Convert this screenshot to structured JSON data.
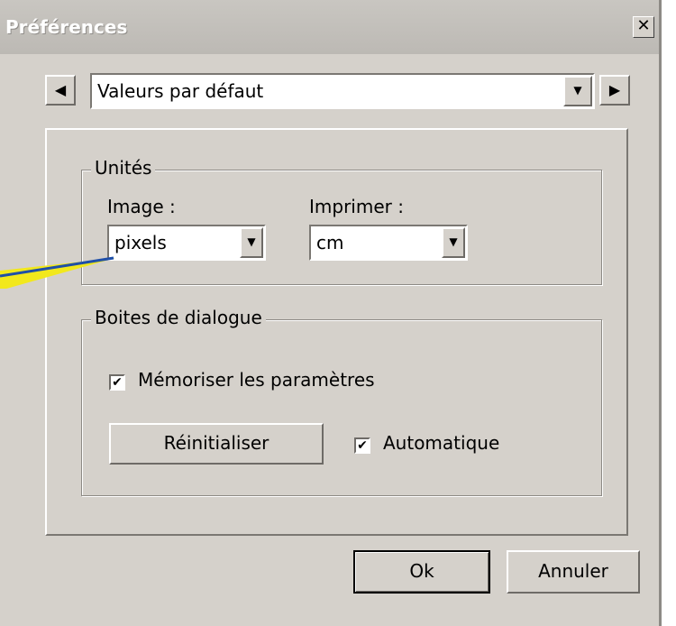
{
  "window": {
    "title": "Préférences",
    "close_glyph": "✕"
  },
  "profile": {
    "selected": "Valeurs par défaut",
    "prev_glyph": "◀",
    "next_glyph": "▶",
    "dropdown_glyph": "▼"
  },
  "units": {
    "legend": "Unités",
    "image_label": "Image :",
    "image_value": "pixels",
    "print_label": "Imprimer :",
    "print_value": "cm"
  },
  "dialogs": {
    "legend": "Boites de dialogue",
    "remember_label": "Mémoriser les paramètres",
    "remember_checked": true,
    "reset_button": "Réinitialiser",
    "auto_label": "Automatique",
    "auto_checked": true
  },
  "footer": {
    "ok_button": "Ok",
    "cancel_button": "Annuler"
  },
  "check_glyph": "✔",
  "colors": {
    "dialog_bg": "#d5d1cb",
    "callout_yellow": "#f2e81c",
    "callout_blue": "#1f4fa8"
  }
}
